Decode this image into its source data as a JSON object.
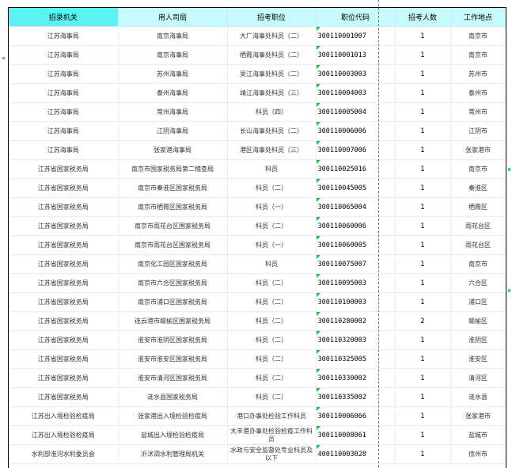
{
  "table": {
    "headers": [
      "招录机关",
      "用人司局",
      "招考职位",
      "职位代码",
      "招考人数",
      "工作地点"
    ],
    "rows": [
      [
        "江苏海事局",
        "南京海事局",
        "大厂海事处科员（二）",
        "300110001007",
        "1",
        "南京市"
      ],
      [
        "江苏海事局",
        "南京海事局",
        "栖霞海事处科员（二）",
        "300110001013",
        "1",
        "南京市"
      ],
      [
        "江苏海事局",
        "苏州海事局",
        "吴江海事处科员（二）",
        "300110003003",
        "1",
        "苏州市"
      ],
      [
        "江苏海事局",
        "泰州海事局",
        "靖江海事处科员（三）",
        "300110004003",
        "1",
        "泰州市"
      ],
      [
        "江苏海事局",
        "常州海事局",
        "科员（四）",
        "300110005004",
        "1",
        "常州市"
      ],
      [
        "江苏海事局",
        "江阴海事局",
        "长山海事处科员（二）",
        "300110006006",
        "1",
        "江阴市"
      ],
      [
        "江苏海事局",
        "张家港海事局",
        "港区海事处科员（三）",
        "300110007006",
        "1",
        "张家港市"
      ],
      [
        "江苏省国家税务局",
        "南京市国家税务局第二稽查局",
        "科员",
        "300110025016",
        "1",
        "南京市"
      ],
      [
        "江苏省国家税务局",
        "南京市秦淮区国家税务局",
        "科员（二）",
        "300110045005",
        "1",
        "秦淮区"
      ],
      [
        "江苏省国家税务局",
        "南京市栖霞区国家税务局",
        "科员（一）",
        "300110065004",
        "1",
        "栖霞区"
      ],
      [
        "江苏省国家税务局",
        "南京市雨花台区国家税务局",
        "科员（二）",
        "300110060006",
        "1",
        "雨花台区"
      ],
      [
        "江苏省国家税务局",
        "南京市雨花台区国家税务局",
        "科员（一）",
        "300110060005",
        "1",
        "雨花台区"
      ],
      [
        "江苏省国家税务局",
        "南京化工园区国家税务局",
        "科员",
        "300110075007",
        "1",
        "南京市"
      ],
      [
        "江苏省国家税务局",
        "南京市六合区国家税务局",
        "科员（二）",
        "300110095003",
        "1",
        "六合区"
      ],
      [
        "江苏省国家税务局",
        "南京市浦口区国家税务局",
        "科员（二）",
        "300110100003",
        "1",
        "浦口区"
      ],
      [
        "江苏省国家税务局",
        "连云港市赣榆区国家税务局",
        "科员（二）",
        "300110280002",
        "2",
        "赣榆区"
      ],
      [
        "江苏省国家税务局",
        "淮安市淮阴区国家税务局",
        "科员（二）",
        "300110320003",
        "1",
        "淮阴区"
      ],
      [
        "江苏省国家税务局",
        "淮安市淮安区国家税务局",
        "科员（二）",
        "300110325005",
        "1",
        "淮安区"
      ],
      [
        "江苏省国家税务局",
        "淮安市清河区国家税务局",
        "科员（二）",
        "300110330002",
        "1",
        "清河区"
      ],
      [
        "江苏省国家税务局",
        "涟水县国家税务局",
        "科员（二）",
        "300110335002",
        "1",
        "涟水县"
      ],
      [
        "江苏出入境检验检疫局",
        "张家港出入境检验检疫局",
        "港口办事处检验工作科员",
        "300110006066",
        "1",
        "张家港市"
      ],
      [
        "江苏出入境检验检疫局",
        "盐城出入境检验检疫局",
        "大丰港办事处检验检疫工作科员",
        "300110008061",
        "1",
        "盐城市"
      ],
      [
        "水利部淮河水利委员会",
        "沂沭泗水利管理局机关",
        "水政与安全监督处专业科员及以下",
        "400110003028",
        "1",
        "徐州市"
      ]
    ]
  }
}
